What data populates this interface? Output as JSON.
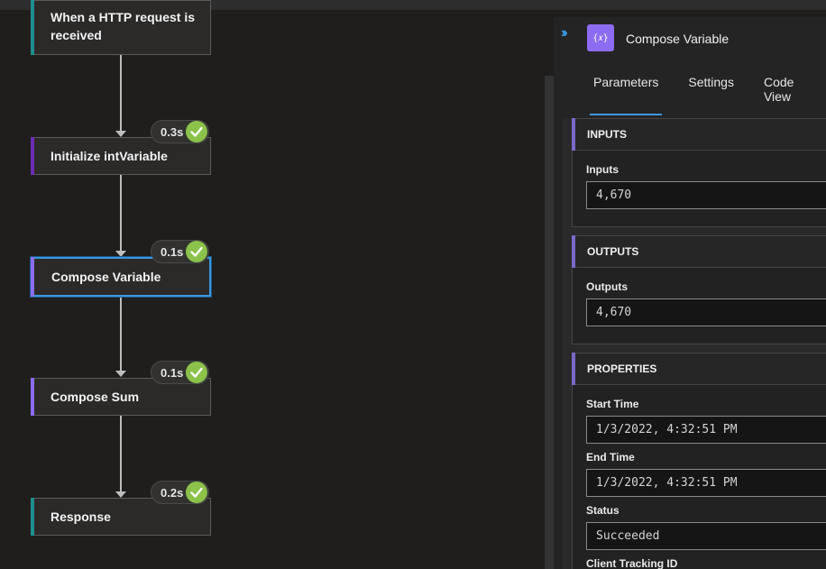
{
  "flow": {
    "nodes": [
      {
        "title": "When a HTTP request is received",
        "accent": "#1e8f8f"
      },
      {
        "title": "Initialize intVariable",
        "accent": "#6b2bb3",
        "duration": "0.3s"
      },
      {
        "title": "Compose Variable",
        "accent": "#8c6cf0",
        "duration": "0.1s"
      },
      {
        "title": "Compose Sum",
        "accent": "#8c6cf0",
        "duration": "0.1s"
      },
      {
        "title": "Response",
        "accent": "#1e8f8f",
        "duration": "0.2s"
      }
    ],
    "status_color": "#8ac24a"
  },
  "panel": {
    "icon_glyph": "{𝑥}",
    "title": "Compose Variable",
    "tabs": [
      {
        "label": "Parameters",
        "active": true
      },
      {
        "label": "Settings",
        "active": false
      },
      {
        "label": "Code View",
        "active": false
      }
    ],
    "inputs": {
      "header": "INPUTS",
      "label": "Inputs",
      "value": "4,670"
    },
    "outputs": {
      "header": "OUTPUTS",
      "label": "Outputs",
      "value": "4,670"
    },
    "properties": {
      "header": "PROPERTIES",
      "start_time_label": "Start Time",
      "start_time": "1/3/2022, 4:32:51 PM",
      "end_time_label": "End Time",
      "end_time": "1/3/2022, 4:32:51 PM",
      "status_label": "Status",
      "status": "Succeeded",
      "tracking_label": "Client Tracking ID"
    }
  },
  "colors": {
    "accent_blue": "#3a96dd",
    "background": "#1f1e1d"
  }
}
